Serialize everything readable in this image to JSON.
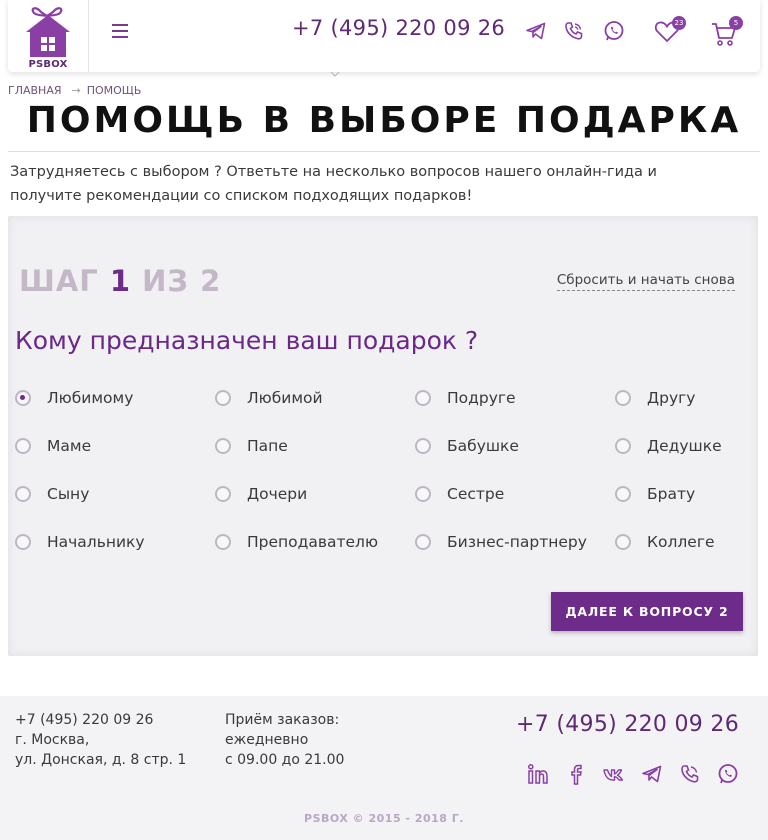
{
  "header": {
    "logo_text": "PSBOX",
    "phone": "+7 (495) 220 09 26",
    "favorites_count": "23",
    "cart_count": "5",
    "icons": [
      "menu-icon",
      "telegram-icon",
      "viber-icon",
      "whatsapp-icon",
      "heart-icon",
      "cart-icon"
    ]
  },
  "breadcrumb": {
    "home": "ГЛАВНАЯ",
    "separator": "→",
    "current": "ПОМОЩЬ"
  },
  "page": {
    "title": "ПОМОЩЬ В ВЫБОРЕ ПОДАРКА",
    "intro": "Затрудняетесь с выбором ? Ответьте на несколько вопросов нашего онлайн-гида и получите рекомендации со списком подходящих подарков!"
  },
  "quiz": {
    "step_word": "ШАГ",
    "step_current": "1",
    "step_of": "ИЗ",
    "step_total": "2",
    "reset_label": "Сбросить и начать снова",
    "question": "Кому предназначен ваш подарок ?",
    "selected_index": 0,
    "options": [
      "Любимому",
      "Любимой",
      "Подруге",
      "Другу",
      "Маме",
      "Папе",
      "Бабушке",
      "Дедушке",
      "Сыну",
      "Дочери",
      "Сестре",
      "Брату",
      "Начальнику",
      "Преподавателю",
      "Бизнес-партнеру",
      "Коллеге"
    ],
    "next_label": "ДАЛЕЕ К ВОПРОСУ 2"
  },
  "footer": {
    "phone_small": "+7 (495) 220 09 26",
    "city": "г. Москва,",
    "address": "ул. Донская, д. 8 стр. 1",
    "orders_title": "Приём заказов:",
    "orders_days": "ежедневно",
    "orders_hours": "с 09.00 до 21.00",
    "phone_large": "+7 (495) 220 09 26",
    "social_icons": [
      "linkedin-icon",
      "facebook-icon",
      "vk-icon",
      "telegram-icon",
      "viber-icon",
      "whatsapp-icon"
    ],
    "copyright": "PSBOX © 2015 - 2018 Г."
  },
  "colors": {
    "brand": "#6e2c8a",
    "muted_step": "#c3b7c8",
    "panel_bg": "#f1f0f3"
  }
}
